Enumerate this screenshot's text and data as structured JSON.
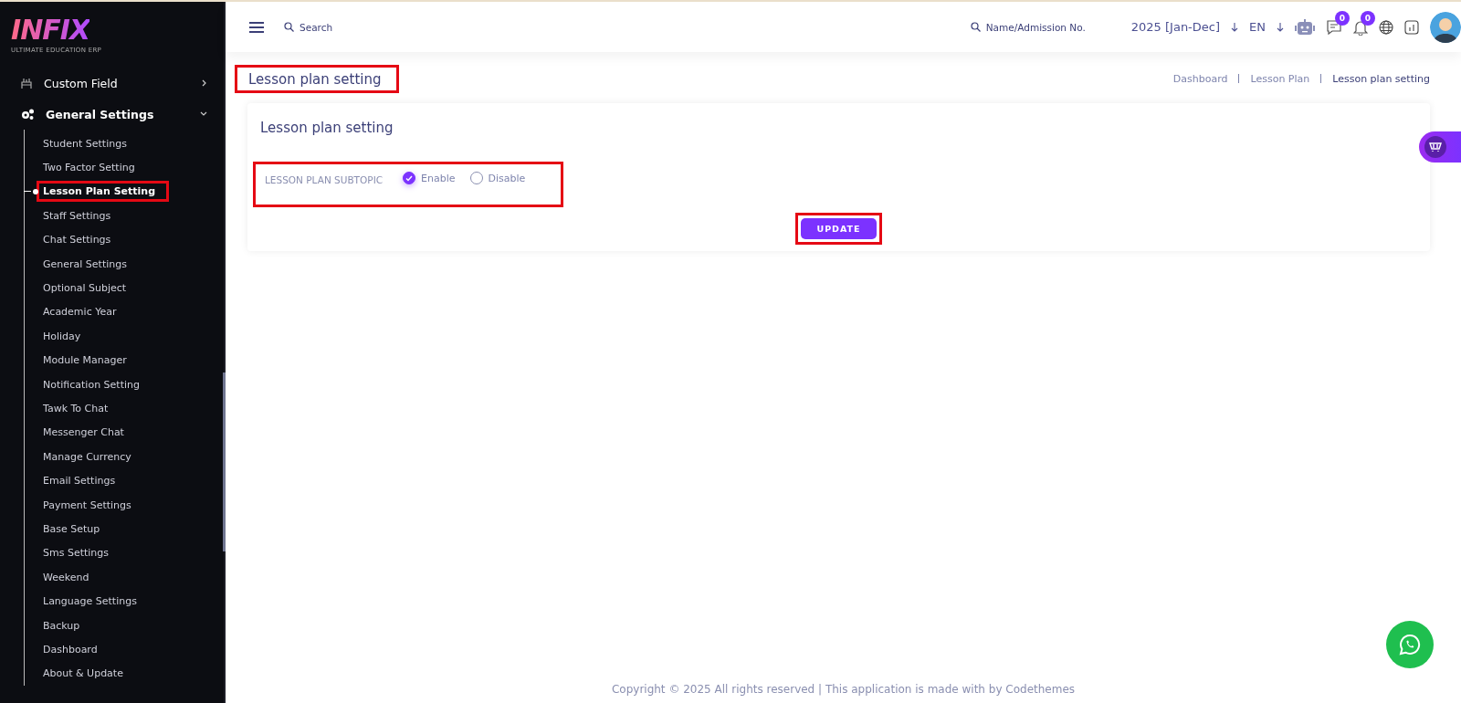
{
  "logo": {
    "title": "INFIX",
    "subtitle": "ULTIMATE EDUCATION ERP"
  },
  "sidebar": {
    "items": [
      {
        "label": "Custom Field",
        "expanded": false
      },
      {
        "label": "General Settings",
        "expanded": true,
        "children": [
          {
            "label": "Student Settings",
            "selected": false,
            "highlighted": false
          },
          {
            "label": "Two Factor Setting",
            "selected": false,
            "highlighted": false
          },
          {
            "label": "Lesson Plan Setting",
            "selected": true,
            "highlighted": true
          },
          {
            "label": "Staff Settings",
            "selected": false,
            "highlighted": false
          },
          {
            "label": "Chat Settings",
            "selected": false,
            "highlighted": false
          },
          {
            "label": "General Settings",
            "selected": false,
            "highlighted": false
          },
          {
            "label": "Optional Subject",
            "selected": false,
            "highlighted": false
          },
          {
            "label": "Academic Year",
            "selected": false,
            "highlighted": false
          },
          {
            "label": "Holiday",
            "selected": false,
            "highlighted": false
          },
          {
            "label": "Module Manager",
            "selected": false,
            "highlighted": false
          },
          {
            "label": "Notification Setting",
            "selected": false,
            "highlighted": false
          },
          {
            "label": "Tawk To Chat",
            "selected": false,
            "highlighted": false
          },
          {
            "label": "Messenger Chat",
            "selected": false,
            "highlighted": false
          },
          {
            "label": "Manage Currency",
            "selected": false,
            "highlighted": false
          },
          {
            "label": "Email Settings",
            "selected": false,
            "highlighted": false
          },
          {
            "label": "Payment Settings",
            "selected": false,
            "highlighted": false
          },
          {
            "label": "Base Setup",
            "selected": false,
            "highlighted": false
          },
          {
            "label": "Sms Settings",
            "selected": false,
            "highlighted": false
          },
          {
            "label": "Weekend",
            "selected": false,
            "highlighted": false
          },
          {
            "label": "Language Settings",
            "selected": false,
            "highlighted": false
          },
          {
            "label": "Backup",
            "selected": false,
            "highlighted": false
          },
          {
            "label": "Dashboard",
            "selected": false,
            "highlighted": false
          },
          {
            "label": "About & Update",
            "selected": false,
            "highlighted": false
          }
        ]
      }
    ]
  },
  "topbar": {
    "search": {
      "placeholder": "Search"
    },
    "student_search": {
      "placeholder": "Name/Admission No."
    },
    "session": "2025 [Jan-Dec]",
    "language": "EN",
    "chat_badge": "0",
    "notification_badge": "0"
  },
  "page": {
    "title": "Lesson plan setting",
    "title_highlighted": true,
    "breadcrumbs": [
      {
        "label": "Dashboard",
        "current": false
      },
      {
        "label": "Lesson Plan",
        "current": false
      },
      {
        "label": "Lesson plan setting",
        "current": true
      }
    ]
  },
  "card": {
    "title": "Lesson plan setting",
    "field": {
      "label": "LESSON PLAN SUBTOPIC",
      "highlighted": true,
      "options": [
        {
          "label": "Enable",
          "selected": true
        },
        {
          "label": "Disable",
          "selected": false
        }
      ]
    },
    "button": {
      "label": "UPDATE",
      "highlighted": true
    }
  },
  "footer": "Copyright © 2025 All rights reserved | This application is made with by Codethemes"
}
